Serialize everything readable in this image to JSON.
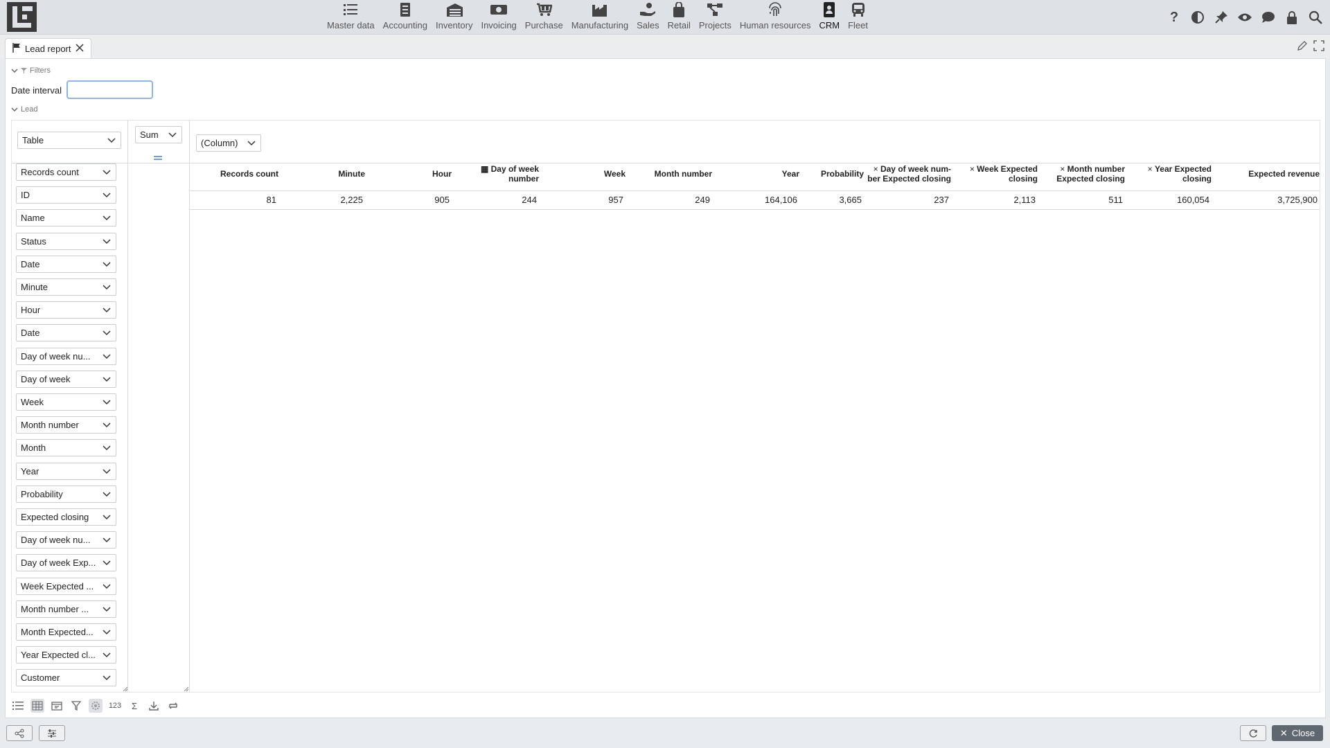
{
  "nav": [
    {
      "label": "Master data",
      "icon": "list-icon"
    },
    {
      "label": "Accounting",
      "icon": "document-icon"
    },
    {
      "label": "Inventory",
      "icon": "warehouse-icon"
    },
    {
      "label": "Invoicing",
      "icon": "money-icon"
    },
    {
      "label": "Purchase",
      "icon": "cart-icon"
    },
    {
      "label": "Manufacturing",
      "icon": "factory-icon"
    },
    {
      "label": "Sales",
      "icon": "hand-coin-icon"
    },
    {
      "label": "Retail",
      "icon": "shopping-bag-icon"
    },
    {
      "label": "Projects",
      "icon": "project-icon"
    },
    {
      "label": "Human resources",
      "icon": "fingerprint-icon"
    },
    {
      "label": "CRM",
      "icon": "contact-icon"
    },
    {
      "label": "Fleet",
      "icon": "bus-icon"
    }
  ],
  "active_nav": "CRM",
  "tab": {
    "label": "Lead report"
  },
  "filters": {
    "section_label": "Filters",
    "date_label": "Date interval",
    "date_value": ""
  },
  "lead_section": "Lead",
  "view_select": "Table",
  "agg_select": "Sum",
  "column_select": "(Column)",
  "fields": [
    "Records count",
    "ID",
    "Name",
    "Status",
    "Date",
    "Minute",
    "Hour",
    "Date",
    "Day of week nu...",
    "Day of week",
    "Week",
    "Month number",
    "Month",
    "Year",
    "Probability",
    "Expected closing",
    "Day of week nu...",
    "Day of week Exp...",
    "Week Expected ...",
    "Month number ...",
    "Month Expected...",
    "Year Expected cl...",
    "Customer"
  ],
  "headers": [
    {
      "line1": "Records count",
      "line2": ""
    },
    {
      "line1": "Minute",
      "line2": ""
    },
    {
      "line1": "Hour",
      "line2": ""
    },
    {
      "line1": "Day of week",
      "line2": "number"
    },
    {
      "line1": "Week",
      "line2": ""
    },
    {
      "line1": "Month number",
      "line2": ""
    },
    {
      "line1": "Year",
      "line2": ""
    },
    {
      "line1": "Probability",
      "line2": ""
    },
    {
      "line1": "Day of week num-",
      "line2": "ber Expected closing"
    },
    {
      "line1": "Week Expected",
      "line2": "closing"
    },
    {
      "line1": "Month number",
      "line2": "Expected closing"
    },
    {
      "line1": "Year Expected",
      "line2": "closing"
    },
    {
      "line1": "Expected revenue",
      "line2": ""
    }
  ],
  "values": [
    "81",
    "2,225",
    "905",
    "244",
    "957",
    "249",
    "164,106",
    "3,665",
    "237",
    "2,113",
    "511",
    "160,054",
    "3,725,900"
  ],
  "bottom_count_label": "123",
  "close_label": "Close"
}
